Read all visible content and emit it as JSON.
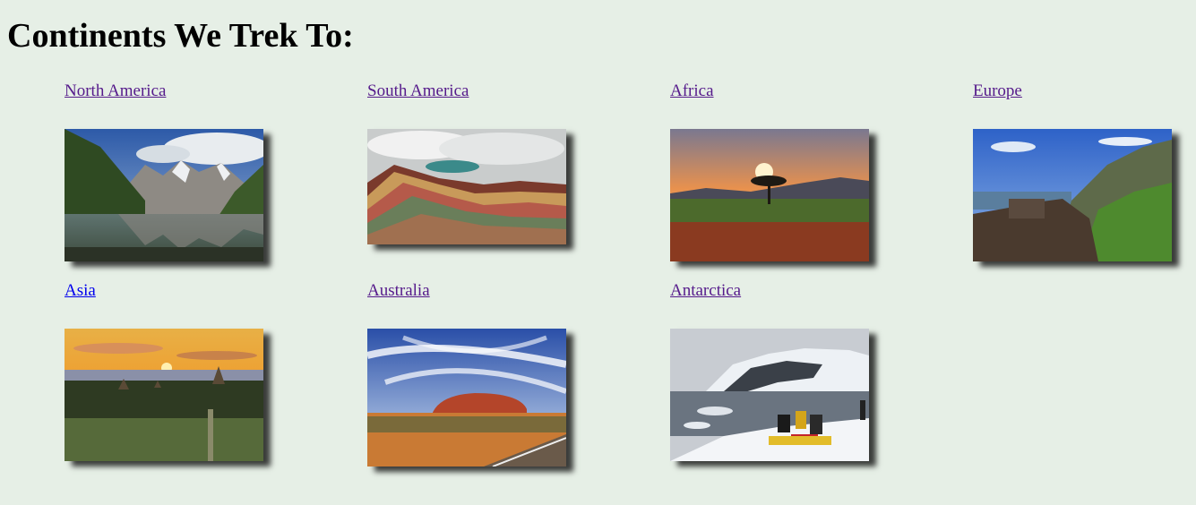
{
  "page": {
    "heading": "Continents We Trek To:"
  },
  "continents": [
    {
      "name": "North America",
      "image": "north-america-mountain-lake-image"
    },
    {
      "name": "South America",
      "image": "rainbow-mountain-image"
    },
    {
      "name": "Africa",
      "image": "savanna-sunset-acacia-image"
    },
    {
      "name": "Europe",
      "image": "coastal-mountain-village-image"
    },
    {
      "name": "Asia",
      "image": "temples-sunset-image"
    },
    {
      "name": "Australia",
      "image": "uluru-desert-road-image"
    },
    {
      "name": "Antarctica",
      "image": "glacier-expedition-image"
    }
  ],
  "colors": {
    "background": "#e6efe6",
    "visited_link": "#551a8b",
    "unvisited_link": "#0000ee"
  }
}
